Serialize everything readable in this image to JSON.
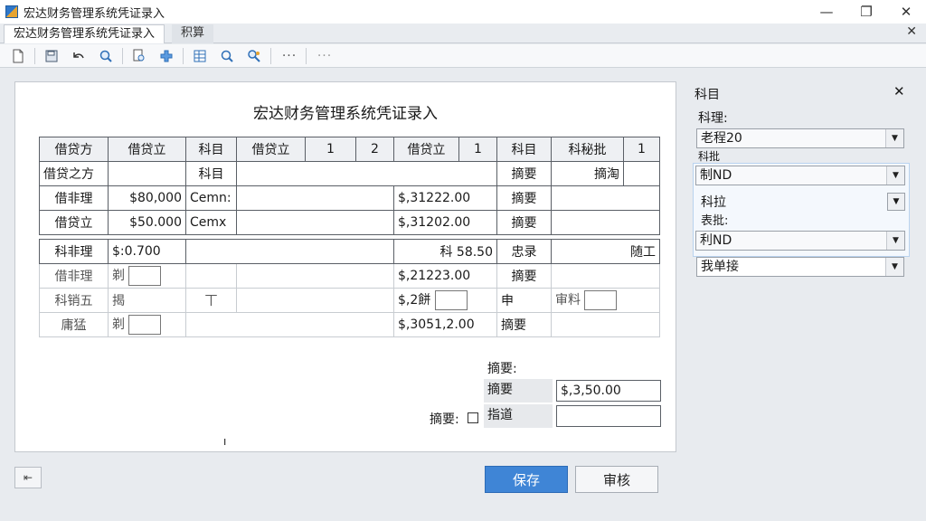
{
  "window": {
    "title": "宏达财务管理系统凭证录入",
    "minimize": "—",
    "maximize": "❐",
    "close": "✕"
  },
  "tabs": [
    {
      "label": "宏达财务管理系统凭证录入"
    },
    {
      "label": "积算"
    }
  ],
  "tab_close": "✕",
  "toolbar": {
    "more_1": "···",
    "more_2": "···",
    "icons": [
      "new-document-icon",
      "save-icon",
      "undo-icon",
      "zoom-icon",
      "search-doc-icon",
      "add-dropdown-icon",
      "grid-icon",
      "find-icon",
      "find-replace-icon"
    ]
  },
  "form": {
    "title": "宏达财务管理系统凭证录入",
    "header": [
      "借贷方",
      "借贷立",
      "科目",
      "借贷立",
      "1",
      "2",
      "借贷立",
      "1",
      "科目",
      "科秘批",
      "1"
    ],
    "subheader": [
      "借贷之方",
      "",
      "科目",
      "",
      "",
      "",
      "",
      "",
      "摘要",
      "摘淘",
      ""
    ],
    "rows": [
      {
        "c1": "借非理",
        "c2": "$80,000",
        "c3": "Cemn:",
        "amount": "$,31222.00",
        "summary": "摘要"
      },
      {
        "c1": "借贷立",
        "c2": "$50.000",
        "c3": "Cemx",
        "amount": "$,31202.00",
        "summary": "摘要"
      }
    ],
    "rows2": [
      {
        "c1": "科非理",
        "c2": "$:0.700",
        "c3": "",
        "amount": "科 58.50",
        "summary": "忠录",
        "extra": "随工"
      },
      {
        "c1": "借非理",
        "c2": "剃",
        "c3": "",
        "amount": "$,21223.00",
        "summary": "摘要",
        "extra": ""
      },
      {
        "c1": "科销五",
        "c2": "揭",
        "c3": "丅",
        "amount": "$,2餅",
        "summary": "申",
        "extra": "审料"
      },
      {
        "c1": "庸猛",
        "c2": "剃",
        "c3": "",
        "amount": "$,3051,2.00",
        "summary": "摘要",
        "extra": ""
      }
    ]
  },
  "summary": {
    "label_top": "摘要:",
    "row1_label": "摘要",
    "row1_value": "$,3,50.00",
    "row2_check_label": "摘要:",
    "row2_label": "指道",
    "row2_value": "",
    "mark": "ı"
  },
  "buttons": {
    "back": "⇤",
    "save": "保存",
    "audit": "审核"
  },
  "side": {
    "title": "科目",
    "close": "✕",
    "label1": "科理:",
    "combo1": "老程20",
    "label1b": "科批",
    "combo2": "制ND",
    "label2": "科拉",
    "label2b": "表批:",
    "combo3": "利ND",
    "combo4": "我单接"
  },
  "colors": {
    "primary_button": "#3f85d6",
    "panel_border": "#c4c8ce",
    "background": "#e8ebef"
  }
}
